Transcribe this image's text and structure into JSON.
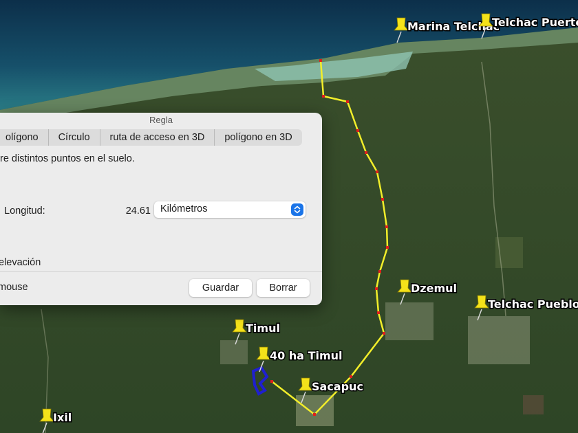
{
  "map": {
    "places": [
      {
        "name": "Marina Telchac"
      },
      {
        "name": "Telchac Puerto"
      },
      {
        "name": "Dzemul"
      },
      {
        "name": "Telchac Pueblo"
      },
      {
        "name": "Timul"
      },
      {
        "name": "40 ha Timul"
      },
      {
        "name": "Sacapuc"
      },
      {
        "name": "Ixil"
      }
    ],
    "route_color": "#f2ee2a",
    "vertex_color": "#e0201c",
    "polygon_color": "#1f1fd0"
  },
  "dialog": {
    "title": "Regla",
    "tabs": [
      "olígono",
      "Círculo",
      "ruta de acceso en 3D",
      "polígono en 3D"
    ],
    "instruction": "re distintos puntos en el suelo.",
    "length_label": "Longitud:",
    "length_value": "24.61",
    "unit": "Kilómetros",
    "elevation_label": "elevación",
    "mouse_label": "mouse",
    "save_label": "Guardar",
    "clear_label": "Borrar"
  }
}
